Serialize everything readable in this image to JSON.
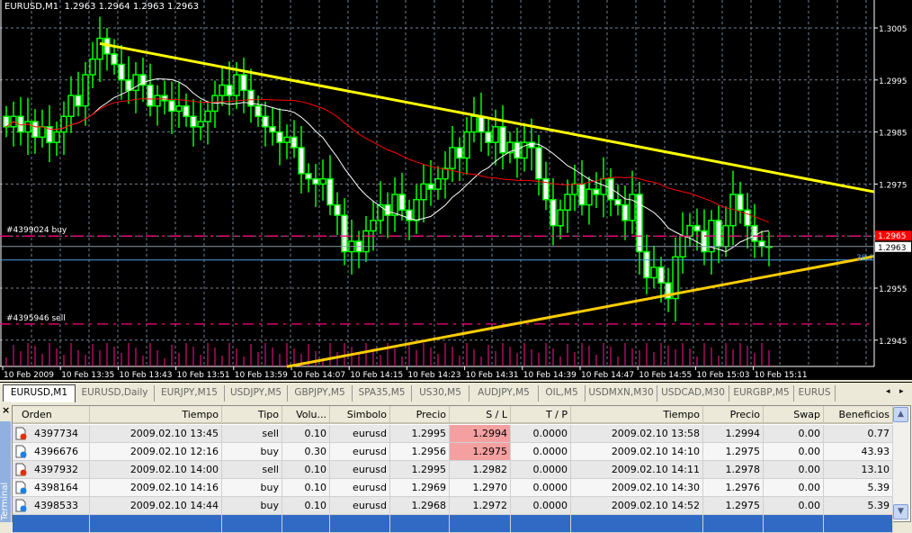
{
  "chart": {
    "title": "EURUSD,M1",
    "ohlc_header": "1.2963 1.2964 1.2963 1.2963",
    "price_ticks": [
      "1.3005",
      "1.2995",
      "1.2985",
      "1.2975",
      "1.2965",
      "1.2955",
      "1.2945"
    ],
    "time_labels": [
      "10 Feb 2009",
      "10 Feb 13:35",
      "10 Feb 13:43",
      "10 Feb 13:51",
      "10 Feb 13:59",
      "10 Feb 14:07",
      "10 Feb 14:15",
      "10 Feb 14:23",
      "10 Feb 14:31",
      "10 Feb 14:39",
      "10 Feb 14:47",
      "10 Feb 14:55",
      "10 Feb 15:03",
      "10 Feb 15:11"
    ],
    "order_lines": [
      {
        "label": "#4399024 buy",
        "price": 1.2965
      },
      {
        "label": "#4395946 sell",
        "price": 1.29481
      }
    ],
    "bid_price": "1.2963",
    "bid_price_value": 1.2963,
    "marker_price": "1.2965",
    "fib_label": "38.2",
    "fib_price": 1.29605,
    "colors": {
      "bull": "#00ff00",
      "bear_fill": "#ffffff",
      "ma_fast": "#ffffff",
      "ma_slow": "#ff0000",
      "trend_upper": "#ffff00",
      "trend_lower": "#ffcc00",
      "order_line": "#ff0080",
      "volume": "#ff1493",
      "grid": "#708090"
    }
  },
  "chart_data": {
    "type": "candlestick",
    "symbol": "EURUSD",
    "timeframe": "M1",
    "ylim": [
      1.294,
      1.301
    ],
    "closes": [
      1.2986,
      1.2988,
      1.2985,
      1.2987,
      1.2984,
      1.2986,
      1.2983,
      1.2985,
      1.2988,
      1.2992,
      1.299,
      1.2996,
      1.2999,
      1.3003,
      1.3,
      1.2998,
      1.2995,
      1.2993,
      1.2996,
      1.2994,
      1.299,
      1.2992,
      1.2991,
      1.2989,
      1.299,
      1.2988,
      1.2986,
      1.2987,
      1.2989,
      1.2992,
      1.2994,
      1.2992,
      1.2996,
      1.2993,
      1.299,
      1.2988,
      1.2986,
      1.2985,
      1.2983,
      1.2984,
      1.2982,
      1.2977,
      1.2976,
      1.2975,
      1.2976,
      1.2971,
      1.2969,
      1.2962,
      1.2964,
      1.2962,
      1.2966,
      1.2968,
      1.2971,
      1.2969,
      1.2973,
      1.297,
      1.2968,
      1.2972,
      1.2975,
      1.2974,
      1.2976,
      1.2978,
      1.2982,
      1.298,
      1.2985,
      1.2988,
      1.2985,
      1.2983,
      1.2986,
      1.2981,
      1.2983,
      1.298,
      1.2983,
      1.2982,
      1.2976,
      1.2972,
      1.2967,
      1.297,
      1.2973,
      1.2975,
      1.2971,
      1.2974,
      1.2973,
      1.2976,
      1.2972,
      1.2971,
      1.2968,
      1.2973,
      1.2962,
      1.2957,
      1.2959,
      1.2956,
      1.2953,
      1.2961,
      1.2965,
      1.2967,
      1.2966,
      1.2962,
      1.2968,
      1.2963,
      1.2967,
      1.2973,
      1.297,
      1.2967,
      1.2964,
      1.2963,
      1.2963
    ],
    "trendlines": [
      {
        "name": "upper",
        "from": [
          13,
          1.3002
        ],
        "to": [
          121,
          1.29735
        ]
      },
      {
        "name": "lower",
        "from": [
          39,
          1.29399
        ],
        "to": [
          121,
          1.29611
        ]
      }
    ],
    "ma_periods": [
      13,
      34
    ]
  },
  "tabs": [
    "EURUSD,M1",
    "EURUSD,Daily",
    "EURJPY,M15",
    "USDJPY,M5",
    "GBPJPY,M5",
    "SPA35,M5",
    "US30,M5",
    "AUDJPY,M5",
    "OIL,M5",
    "USDMXN,M30",
    "USDCAD,M30",
    "EURGBP,M5",
    "EURUS"
  ],
  "terminal": {
    "close": "×",
    "side_label": "Terminal",
    "columns": [
      "Orden",
      "Tiempo",
      "Tipo",
      "Volu...",
      "Simbolo",
      "Precio",
      "S / L",
      "T / P",
      "Tiempo",
      "Precio",
      "Swap",
      "Beneficios"
    ],
    "rows": [
      {
        "type": "sell",
        "cells": [
          "4397734",
          "2009.02.10 13:45",
          "sell",
          "0.10",
          "eurusd",
          "1.2995",
          "1.2994",
          "0.0000",
          "2009.02.10 13:58",
          "1.2994",
          "0.00",
          "0.77"
        ],
        "sl_hit": true
      },
      {
        "type": "buy",
        "cells": [
          "4396676",
          "2009.02.10 12:16",
          "buy",
          "0.30",
          "eurusd",
          "1.2956",
          "1.2975",
          "0.0000",
          "2009.02.10 14:10",
          "1.2975",
          "0.00",
          "43.93"
        ],
        "sl_hit": true
      },
      {
        "type": "sell",
        "cells": [
          "4397932",
          "2009.02.10 14:00",
          "sell",
          "0.10",
          "eurusd",
          "1.2995",
          "1.2982",
          "0.0000",
          "2009.02.10 14:11",
          "1.2978",
          "0.00",
          "13.10"
        ],
        "sl_hit": false
      },
      {
        "type": "buy",
        "cells": [
          "4398164",
          "2009.02.10 14:16",
          "buy",
          "0.10",
          "eurusd",
          "1.2969",
          "1.2970",
          "0.0000",
          "2009.02.10 14:30",
          "1.2976",
          "0.00",
          "5.39"
        ],
        "sl_hit": false
      },
      {
        "type": "buy",
        "cells": [
          "4398533",
          "2009.02.10 14:44",
          "buy",
          "0.10",
          "eurusd",
          "1.2968",
          "1.2972",
          "0.0000",
          "2009.02.10 14:52",
          "1.2975",
          "0.00",
          "5.39"
        ],
        "sl_hit": false
      }
    ]
  }
}
